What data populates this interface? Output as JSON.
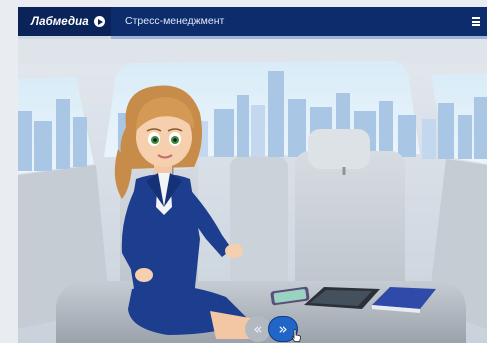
{
  "header": {
    "brand": "Лабмедиа",
    "course_title": "Стресс-менеджмент"
  },
  "navigation": {
    "prev_label": "«",
    "next_label": "»"
  },
  "icons": {
    "brand": "play-circle-icon",
    "menu": "hamburger-menu-icon",
    "cursor": "hand-pointer-icon"
  },
  "colors": {
    "header_bg": "#0d2c6c",
    "brand_bg": "#0a2358",
    "accent": "#2166c7",
    "suit": "#1d3d8f",
    "hair": "#d49a55"
  }
}
